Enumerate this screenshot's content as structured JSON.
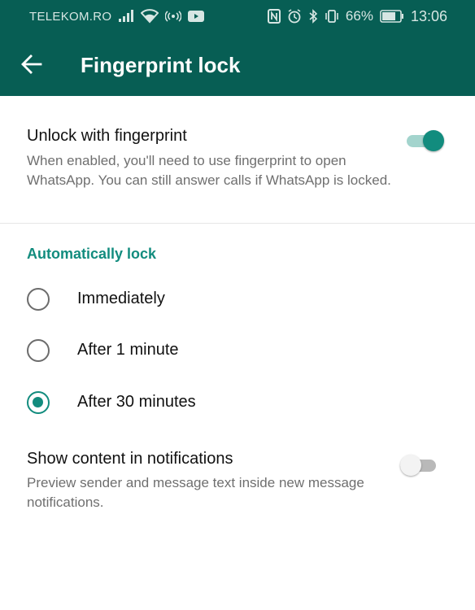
{
  "status_bar": {
    "carrier": "TELEKOM.RO",
    "battery": "66%",
    "time": "13:06",
    "icons": [
      "signal-icon",
      "wifi-icon",
      "hotspot-icon",
      "youtube-icon",
      "nfc-icon",
      "alarm-icon",
      "bluetooth-icon",
      "vibrate-icon",
      "battery-icon"
    ]
  },
  "app_bar": {
    "title": "Fingerprint lock",
    "back_icon": "back-arrow-icon",
    "color": "#075e54"
  },
  "fingerprint": {
    "title": "Unlock with fingerprint",
    "description": "When enabled, you'll need to use fingerprint to open WhatsApp. You can still answer calls if WhatsApp is locked.",
    "enabled": true
  },
  "auto_lock": {
    "header": "Automatically lock",
    "options": [
      {
        "label": "Immediately",
        "selected": false
      },
      {
        "label": "After 1 minute",
        "selected": false
      },
      {
        "label": "After 30 minutes",
        "selected": true
      }
    ]
  },
  "notifications": {
    "title": "Show content in notifications",
    "description": "Preview sender and message text inside new message notifications.",
    "enabled": false
  },
  "colors": {
    "accent": "#128c7e",
    "toolbar": "#075e54"
  }
}
